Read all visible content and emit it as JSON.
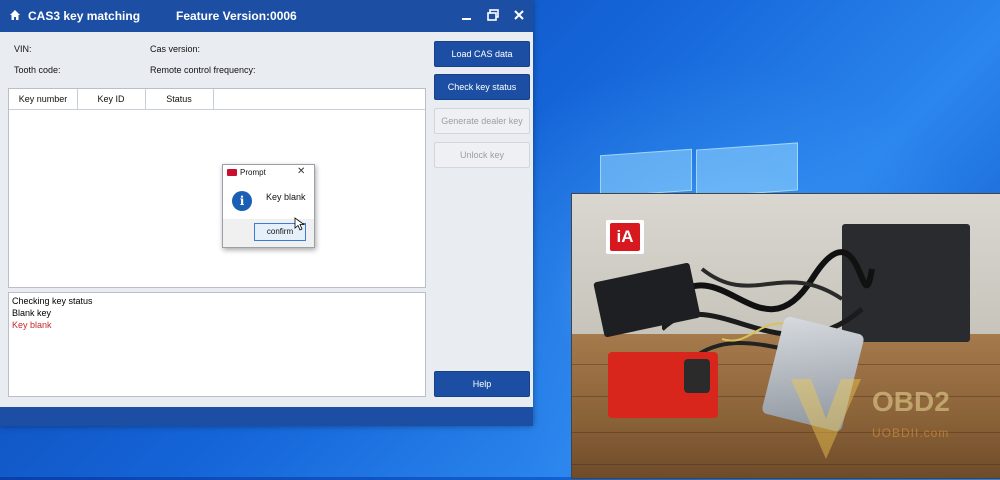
{
  "window": {
    "title": "CAS3 key matching",
    "version": "Feature Version:0006",
    "icons": {
      "home": "home-icon",
      "minimize": "minimize-icon",
      "restore": "restore-icon",
      "close": "close-icon"
    }
  },
  "info": {
    "vin_label": "VIN:",
    "cas_version_label": "Cas version:",
    "tooth_code_label": "Tooth code:",
    "remote_freq_label": "Remote control frequency:"
  },
  "table": {
    "columns": [
      "Key number",
      "Key ID",
      "Status"
    ],
    "rows": []
  },
  "buttons": {
    "load_cas": "Load CAS data",
    "check_key": "Check key status",
    "generate_dealer": "Generate dealer key",
    "unlock": "Unlock key",
    "help": "Help"
  },
  "log": {
    "lines": [
      {
        "text": "Checking key status",
        "color": "#111111"
      },
      {
        "text": "Blank key",
        "color": "#111111"
      },
      {
        "text": "Key blank",
        "color": "#c62828"
      }
    ]
  },
  "prompt": {
    "title": "Prompt",
    "message": "Key blank",
    "confirm": "confirm",
    "icon": "info-icon"
  },
  "video": {
    "logo_text": "iA",
    "watermark": "OBD2",
    "watermark_sub": "UOBDII.com"
  },
  "colors": {
    "accent": "#1c4fa3",
    "error": "#c62828"
  }
}
